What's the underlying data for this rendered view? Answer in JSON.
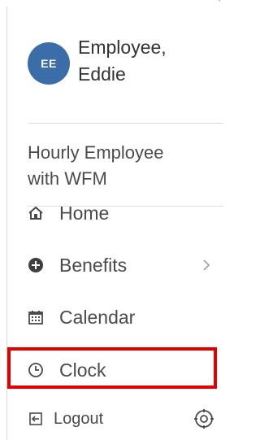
{
  "profile": {
    "avatar_initials": "EE",
    "name": "Employee,\nEddie"
  },
  "role": "Hourly Employee\nwith WFM",
  "nav": {
    "items": [
      {
        "label": "Home",
        "icon": "home-icon"
      },
      {
        "label": "Benefits",
        "icon": "plus-circle-icon",
        "chevron": "chevron-right-icon"
      },
      {
        "label": "Calendar",
        "icon": "calendar-icon"
      },
      {
        "label": "Clock",
        "icon": "clock-icon"
      }
    ]
  },
  "footer": {
    "logout_label": "Logout",
    "logout_icon": "logout-icon",
    "settings_icon": "settings-icon"
  },
  "colors": {
    "avatar_bg": "#3b6ea8",
    "highlight": "#e00000",
    "text": "#4a4a4a"
  }
}
